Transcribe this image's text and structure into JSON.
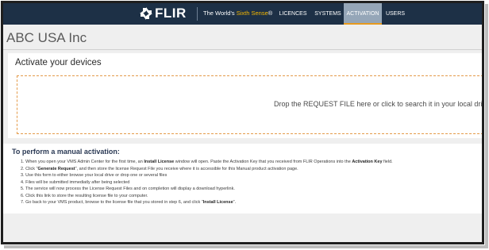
{
  "navbar": {
    "logo_text": "FLIR",
    "tagline_prefix": "The World's ",
    "tagline_accent": "Sixth Sense",
    "tagline_suffix": "®",
    "items": [
      {
        "label": "LICENCES",
        "active": false
      },
      {
        "label": "SYSTEMS",
        "active": false
      },
      {
        "label": "ACTIVATION",
        "active": true
      },
      {
        "label": "USERS",
        "active": false
      }
    ],
    "bg_color": "#1d3046",
    "active_bg": "#95a6b8",
    "active_underline": "#e79a1f"
  },
  "page": {
    "title": "ABC USA Inc"
  },
  "activate": {
    "heading": "Activate your devices",
    "dropzone_text": "Drop the REQUEST FILE here or click to search it in your local drive"
  },
  "instructions": {
    "heading": "To perform a manual activation:",
    "steps": [
      {
        "num": "1.",
        "pre": "When you open your VMS Admin Center for the first time, an ",
        "b1": "Install License",
        "mid": " window will open. Paste the Activation Key that you received from FLIR Operations into the ",
        "b2": "Activation Key",
        "post": " field."
      },
      {
        "num": "2.",
        "pre": "Click \"",
        "b1": "Generate Request",
        "mid": "\", and then store the license Request File you receive where it is accessible for this Manual product activation page.",
        "b2": "",
        "post": ""
      },
      {
        "num": "3.",
        "text": "Use this form to either browse your local drive or drop one or several files"
      },
      {
        "num": "4.",
        "text": "Files will be submitted immediatly after being selected"
      },
      {
        "num": "5.",
        "text": "The service will now process the License Request Files and on completion will display a download hyperlink."
      },
      {
        "num": "6.",
        "text": "Click this link to store the resulting license file to your computer."
      },
      {
        "num": "7.",
        "pre": "Go back to your VMS product, browse to the license file that you stored in step 6, and click \"",
        "b1": "Install License",
        "mid": "\".",
        "b2": "",
        "post": ""
      }
    ]
  }
}
